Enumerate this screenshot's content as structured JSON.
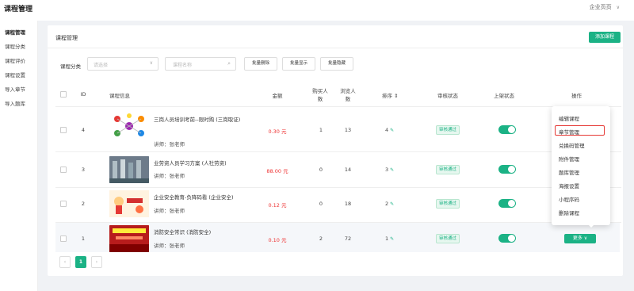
{
  "header": {
    "app_title": "课程管理",
    "company_label": "企业页页",
    "chevron": "∨"
  },
  "sidebar": {
    "items": [
      {
        "label": "课程管理",
        "active": true
      },
      {
        "label": "课程分类"
      },
      {
        "label": "课程评价"
      },
      {
        "label": "课程设置"
      },
      {
        "label": "导入章节"
      },
      {
        "label": "导入题库"
      }
    ]
  },
  "card": {
    "title": "课程管理",
    "add_button": "添加课程"
  },
  "filters": {
    "category_label": "课程分类",
    "category_placeholder": "请选择",
    "name_placeholder": "课程名称",
    "batch_delete": "批量删除",
    "batch_show": "批量显示",
    "batch_hide": "批量隐藏"
  },
  "table": {
    "headers": {
      "id": "ID",
      "info": "课程信息",
      "price": "金额",
      "buyers": "购买人数",
      "views": "浏览人数",
      "sort": "排序",
      "review": "审核状态",
      "status": "上架状态",
      "ops": "操作"
    },
    "rows": [
      {
        "id": "4",
        "title": "三岗人员培训考前--限时购 (三岗取证)",
        "teacher": "讲师：张老师",
        "price": "0.30 元",
        "buyers": "1",
        "views": "13",
        "sort": "4",
        "review": "审核通过"
      },
      {
        "id": "3",
        "title": "业劳资人员学习方案 (人社劳资)",
        "teacher": "讲师：张老师",
        "price": "88.00 元",
        "buyers": "0",
        "views": "14",
        "sort": "3",
        "review": "审核通过"
      },
      {
        "id": "2",
        "title": "企业安全教育-负降码看 (企业安全)",
        "teacher": "讲师：张老师",
        "price": "0.12 元",
        "buyers": "0",
        "views": "18",
        "sort": "2",
        "review": "审核通过"
      },
      {
        "id": "1",
        "title": "消防安全常识 (消防安全)",
        "teacher": "讲师：张老师",
        "price": "0.10 元",
        "buyers": "2",
        "views": "72",
        "sort": "1",
        "review": "审核通过"
      }
    ],
    "more_button": "更多"
  },
  "dropdown": {
    "items": [
      "编辑课程",
      "章节管理",
      "兑换码管理",
      "附件管理",
      "题库管理",
      "海报设置",
      "小程序码",
      "删除课程"
    ],
    "highlighted_index": 1
  },
  "pagination": {
    "prev": "‹",
    "current": "1",
    "next": "›"
  },
  "colors": {
    "accent": "#1bb285",
    "price": "#e33333",
    "highlight_border": "#e53935"
  }
}
